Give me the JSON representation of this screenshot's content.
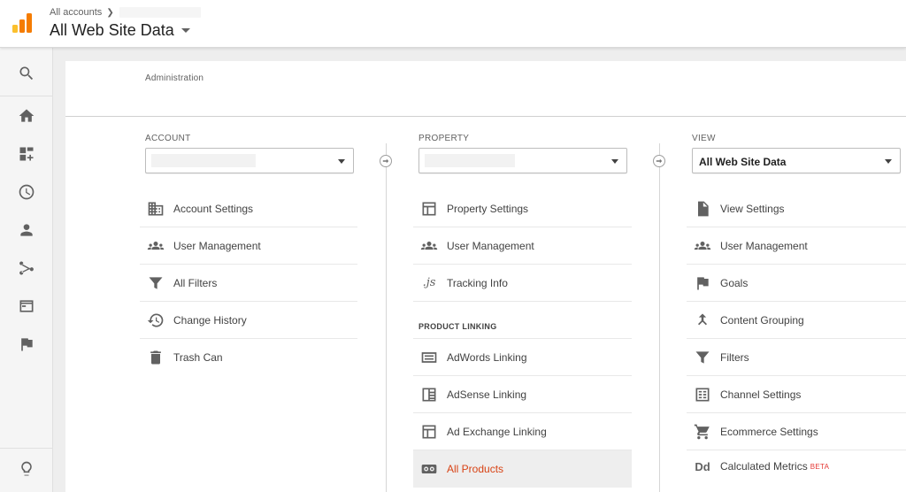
{
  "header": {
    "breadcrumb_root": "All accounts",
    "view_title": "All Web Site Data"
  },
  "colors": {
    "accent_orange": "#f57c00",
    "logo_yellow": "#fbc02d",
    "active_red": "#d84315",
    "beta_red": "#e53935"
  },
  "leftnav": {
    "items": [
      {
        "icon": "search-icon"
      },
      {
        "icon": "home-icon"
      },
      {
        "icon": "customization-icon"
      },
      {
        "icon": "clock-icon"
      },
      {
        "icon": "person-icon"
      },
      {
        "icon": "acquisition-icon"
      },
      {
        "icon": "behavior-icon"
      },
      {
        "icon": "flag-icon"
      }
    ],
    "bottom_icon": "lightbulb-icon"
  },
  "main": {
    "admin_label": "Administration",
    "account": {
      "label": "ACCOUNT",
      "items": [
        {
          "label": "Account Settings",
          "icon": "building-icon"
        },
        {
          "label": "User Management",
          "icon": "people-icon"
        },
        {
          "label": "All Filters",
          "icon": "filter-icon"
        },
        {
          "label": "Change History",
          "icon": "history-icon"
        },
        {
          "label": "Trash Can",
          "icon": "trash-icon"
        }
      ]
    },
    "property": {
      "label": "PROPERTY",
      "items": [
        {
          "label": "Property Settings",
          "icon": "window-icon"
        },
        {
          "label": "User Management",
          "icon": "people-icon"
        },
        {
          "label": "Tracking Info",
          "icon": "js-icon",
          "glyph": ".js"
        }
      ],
      "linking_heading": "PRODUCT LINKING",
      "linking_items": [
        {
          "label": "AdWords Linking",
          "icon": "adwords-icon"
        },
        {
          "label": "AdSense Linking",
          "icon": "adsense-icon"
        },
        {
          "label": "Ad Exchange Linking",
          "icon": "window-icon"
        },
        {
          "label": "All Products",
          "icon": "link-icon",
          "active": true
        }
      ]
    },
    "view": {
      "label": "VIEW",
      "selected": "All Web Site Data",
      "items": [
        {
          "label": "View Settings",
          "icon": "document-icon"
        },
        {
          "label": "User Management",
          "icon": "people-icon"
        },
        {
          "label": "Goals",
          "icon": "flag-icon"
        },
        {
          "label": "Content Grouping",
          "icon": "grouping-icon"
        },
        {
          "label": "Filters",
          "icon": "filter-icon"
        },
        {
          "label": "Channel Settings",
          "icon": "channel-icon"
        },
        {
          "label": "Ecommerce Settings",
          "icon": "cart-icon"
        },
        {
          "label": "Calculated Metrics",
          "icon": "dd-icon",
          "glyph": "Dd",
          "badge": "BETA"
        }
      ]
    }
  }
}
